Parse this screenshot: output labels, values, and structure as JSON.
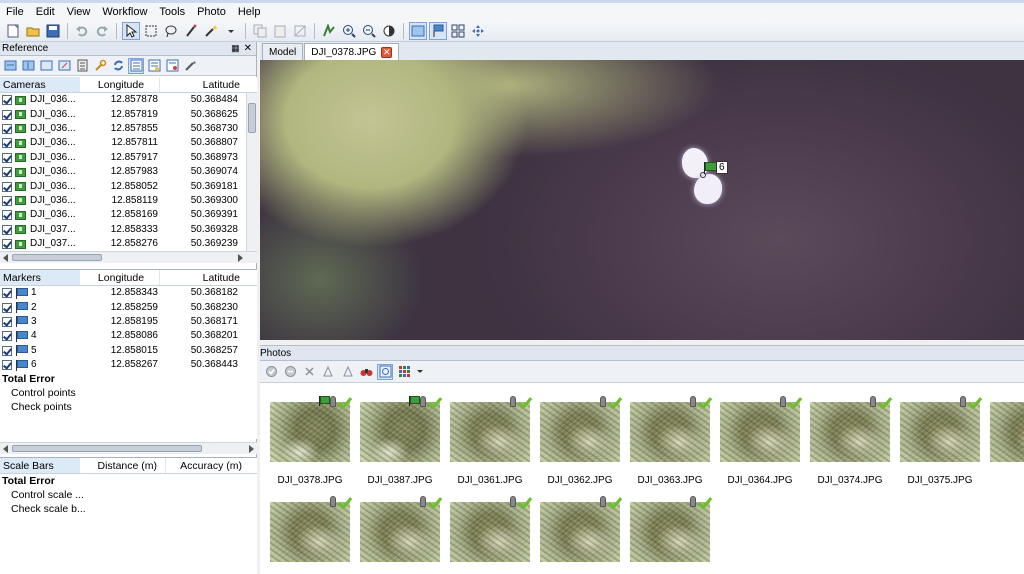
{
  "menu": [
    "File",
    "Edit",
    "View",
    "Workflow",
    "Tools",
    "Photo",
    "Help"
  ],
  "reference": {
    "title": "Reference",
    "cameras": {
      "headers": [
        "Cameras",
        "Longitude",
        "Latitude"
      ],
      "rows": [
        {
          "name": "DJI_036...",
          "lon": "12.857878",
          "lat": "50.368484"
        },
        {
          "name": "DJI_036...",
          "lon": "12.857819",
          "lat": "50.368625"
        },
        {
          "name": "DJI_036...",
          "lon": "12.857855",
          "lat": "50.368730"
        },
        {
          "name": "DJI_036...",
          "lon": "12.857811",
          "lat": "50.368807"
        },
        {
          "name": "DJI_036...",
          "lon": "12.857917",
          "lat": "50.368973"
        },
        {
          "name": "DJI_036...",
          "lon": "12.857983",
          "lat": "50.369074"
        },
        {
          "name": "DJI_036...",
          "lon": "12.858052",
          "lat": "50.369181"
        },
        {
          "name": "DJI_036...",
          "lon": "12.858119",
          "lat": "50.369300"
        },
        {
          "name": "DJI_036...",
          "lon": "12.858169",
          "lat": "50.369391"
        },
        {
          "name": "DJI_037...",
          "lon": "12.858333",
          "lat": "50.369328"
        },
        {
          "name": "DJI_037...",
          "lon": "12.858276",
          "lat": "50.369239"
        }
      ]
    },
    "markers": {
      "headers": [
        "Markers",
        "Longitude",
        "Latitude"
      ],
      "rows": [
        {
          "name": "1",
          "lon": "12.858343",
          "lat": "50.368182"
        },
        {
          "name": "2",
          "lon": "12.858259",
          "lat": "50.368230"
        },
        {
          "name": "3",
          "lon": "12.858195",
          "lat": "50.368171"
        },
        {
          "name": "4",
          "lon": "12.858086",
          "lat": "50.368201"
        },
        {
          "name": "5",
          "lon": "12.858015",
          "lat": "50.368257"
        },
        {
          "name": "6",
          "lon": "12.858267",
          "lat": "50.368443"
        }
      ],
      "total_error": "Total Error",
      "control_points": "Control points",
      "check_points": "Check points"
    },
    "scale_bars": {
      "headers": [
        "Scale Bars",
        "Distance (m)",
        "Accuracy (m)"
      ],
      "total_error": "Total Error",
      "control_scale": "Control scale ...",
      "check_scale": "Check scale b..."
    }
  },
  "tabs": [
    {
      "label": "Model",
      "active": false
    },
    {
      "label": "DJI_0378.JPG",
      "active": true
    }
  ],
  "viewport": {
    "marker_label": "6"
  },
  "photos": {
    "title": "Photos",
    "items": [
      {
        "label": "DJI_0378.JPG",
        "flag": true
      },
      {
        "label": "DJI_0387.JPG",
        "flag": true
      },
      {
        "label": "DJI_0361.JPG",
        "flag": false
      },
      {
        "label": "DJI_0362.JPG",
        "flag": false
      },
      {
        "label": "DJI_0363.JPG",
        "flag": false
      },
      {
        "label": "DJI_0364.JPG",
        "flag": false
      },
      {
        "label": "DJI_0374.JPG",
        "flag": false
      },
      {
        "label": "DJI_0375.JPG",
        "flag": false
      },
      {
        "label": "",
        "flag": false
      },
      {
        "label": "",
        "flag": false
      },
      {
        "label": "",
        "flag": false
      },
      {
        "label": "",
        "flag": false
      },
      {
        "label": "",
        "flag": false
      },
      {
        "label": "",
        "flag": false
      }
    ]
  }
}
